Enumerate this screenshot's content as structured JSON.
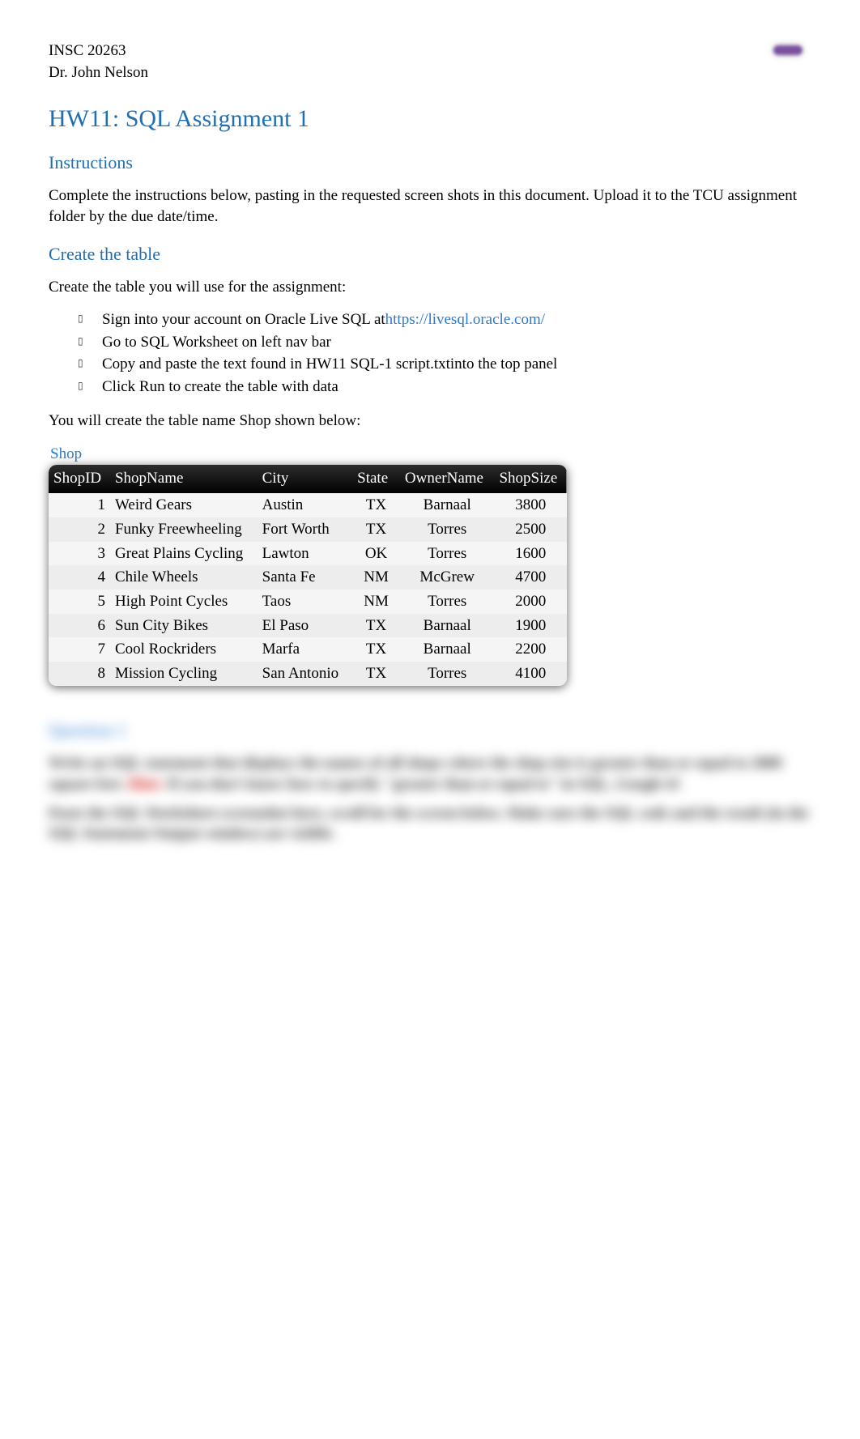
{
  "header": {
    "course": "INSC 20263",
    "instructor": "Dr. John Nelson",
    "badge_label": "",
    "badge_side": ""
  },
  "title": "HW11: SQL Assignment 1",
  "sections": {
    "instructions_heading": "Instructions",
    "instructions_text": "Complete the instructions below, pasting in the requested screen shots in this document. Upload it to the TCU assignment folder by the due date/time.",
    "create_heading": "Create the table",
    "create_intro": "Create the table you will use for the assignment:",
    "bullets": [
      {
        "prefix": "Sign into your account on Oracle Live SQL at",
        "link": "https://livesql.oracle.com/"
      },
      {
        "text": "Go to SQL Worksheet on left nav bar"
      },
      {
        "text": "Copy and paste the text found in  HW11 SQL-1 script.txtinto the top panel"
      },
      {
        "text": "Click Run to create the table with data"
      }
    ],
    "create_outro": "You will create the table name  Shop shown below:"
  },
  "table": {
    "caption": "Shop",
    "headers": {
      "id": "ShopID",
      "name": "ShopName",
      "city": "City",
      "state": "State",
      "owner": "OwnerName",
      "size": "ShopSize"
    },
    "rows": [
      {
        "id": "1",
        "name": "Weird Gears",
        "city": "Austin",
        "state": "TX",
        "owner": "Barnaal",
        "size": "3800"
      },
      {
        "id": "2",
        "name": "Funky Freewheeling",
        "city": "Fort Worth",
        "state": "TX",
        "owner": "Torres",
        "size": "2500"
      },
      {
        "id": "3",
        "name": "Great Plains Cycling",
        "city": "Lawton",
        "state": "OK",
        "owner": "Torres",
        "size": "1600"
      },
      {
        "id": "4",
        "name": "Chile Wheels",
        "city": "Santa Fe",
        "state": "NM",
        "owner": "McGrew",
        "size": "4700"
      },
      {
        "id": "5",
        "name": "High Point Cycles",
        "city": "Taos",
        "state": "NM",
        "owner": "Torres",
        "size": "2000"
      },
      {
        "id": "6",
        "name": "Sun City Bikes",
        "city": "El Paso",
        "state": "TX",
        "owner": "Barnaal",
        "size": "1900"
      },
      {
        "id": "7",
        "name": "Cool Rockriders",
        "city": "Marfa",
        "state": "TX",
        "owner": "Barnaal",
        "size": "2200"
      },
      {
        "id": "8",
        "name": "Mission Cycling",
        "city": "San Antonio",
        "state": "TX",
        "owner": "Torres",
        "size": "4100"
      }
    ]
  },
  "blurred": {
    "heading": "Question 1",
    "line1a": "Write an SQL statement that displays the names of all shops where the shop size is greater than or equal to 2000 square feet.",
    "hint_label": "Hint:",
    "line1b": " If you don't know how to specify \"greater than or equal to\" in SQL, Google it!",
    "line2": "Paste the SQL Worksheet screenshot here, scroll for the screen below. Make sure the SQL code and the result (in the SQL Statement Output window) are visible."
  }
}
